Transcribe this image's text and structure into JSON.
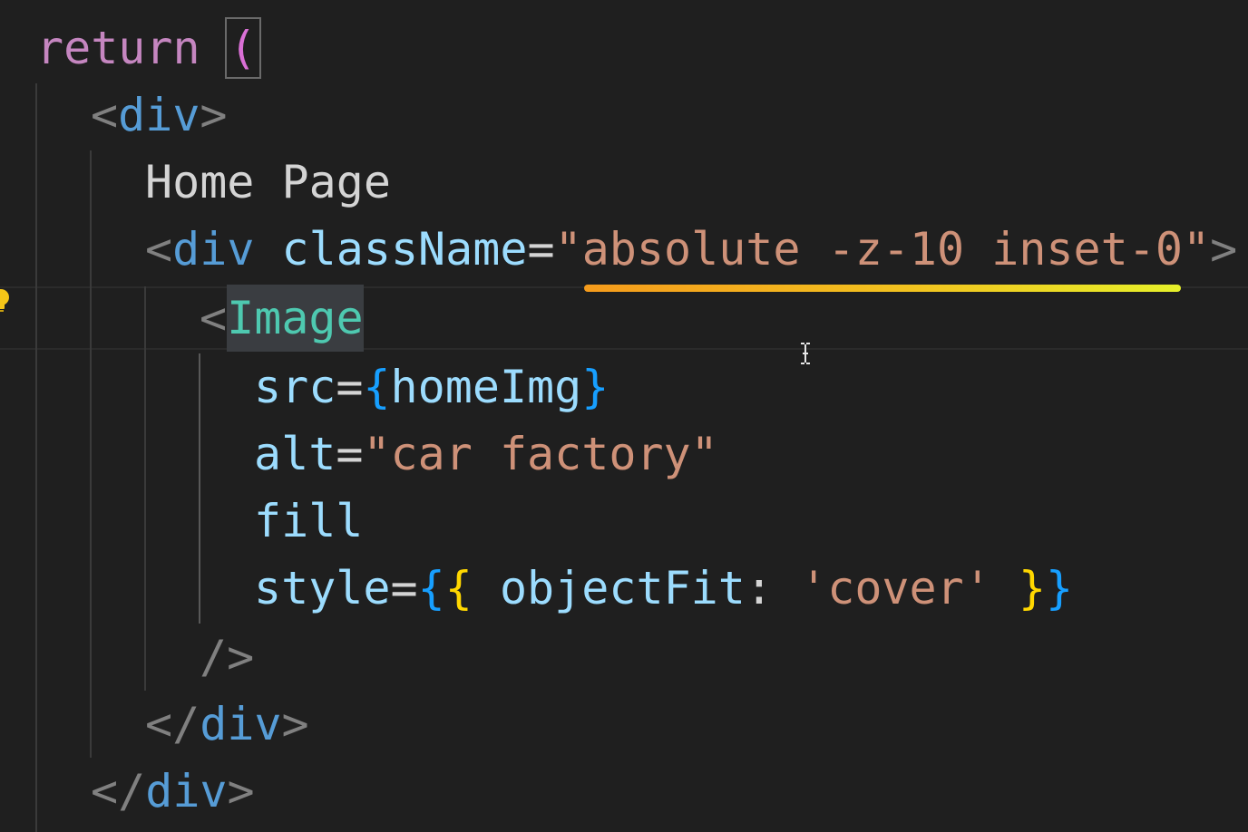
{
  "editor": {
    "lines": [
      {
        "indent": 0,
        "tokens": [
          "return",
          "("
        ]
      },
      {
        "tokens": [
          "<",
          "div",
          ">"
        ]
      },
      {
        "tokens": [
          "Home Page"
        ]
      },
      {
        "tokens": [
          "<",
          "div",
          "className",
          "=",
          "\"",
          "absolute -z-10 inset-0",
          "\"",
          ">"
        ]
      },
      {
        "tokens": [
          "<",
          "Image"
        ]
      },
      {
        "tokens": [
          "src",
          "=",
          "{",
          "homeImg",
          "}"
        ]
      },
      {
        "tokens": [
          "alt",
          "=",
          "\"",
          "car factory",
          "\""
        ]
      },
      {
        "tokens": [
          "fill"
        ]
      },
      {
        "tokens": [
          "style",
          "=",
          "{",
          "{",
          "objectFit",
          ":",
          "'cover'",
          "}",
          "}"
        ]
      },
      {
        "tokens": [
          "/>"
        ]
      },
      {
        "tokens": [
          "</",
          "div",
          ">"
        ]
      },
      {
        "tokens": [
          "</",
          "div",
          ">"
        ]
      }
    ],
    "icons": {
      "lightbulb": "lightbulb-icon",
      "cursor": "text-cursor-icon"
    },
    "colors": {
      "background": "#1f1f1f",
      "keyword": "#c586c0",
      "tag": "#569cd6",
      "attribute": "#9cdcfe",
      "string": "#ce9178",
      "component": "#4ec9b0",
      "squiggle_start": "#f59b1c",
      "squiggle_end": "#e6f02a"
    }
  }
}
